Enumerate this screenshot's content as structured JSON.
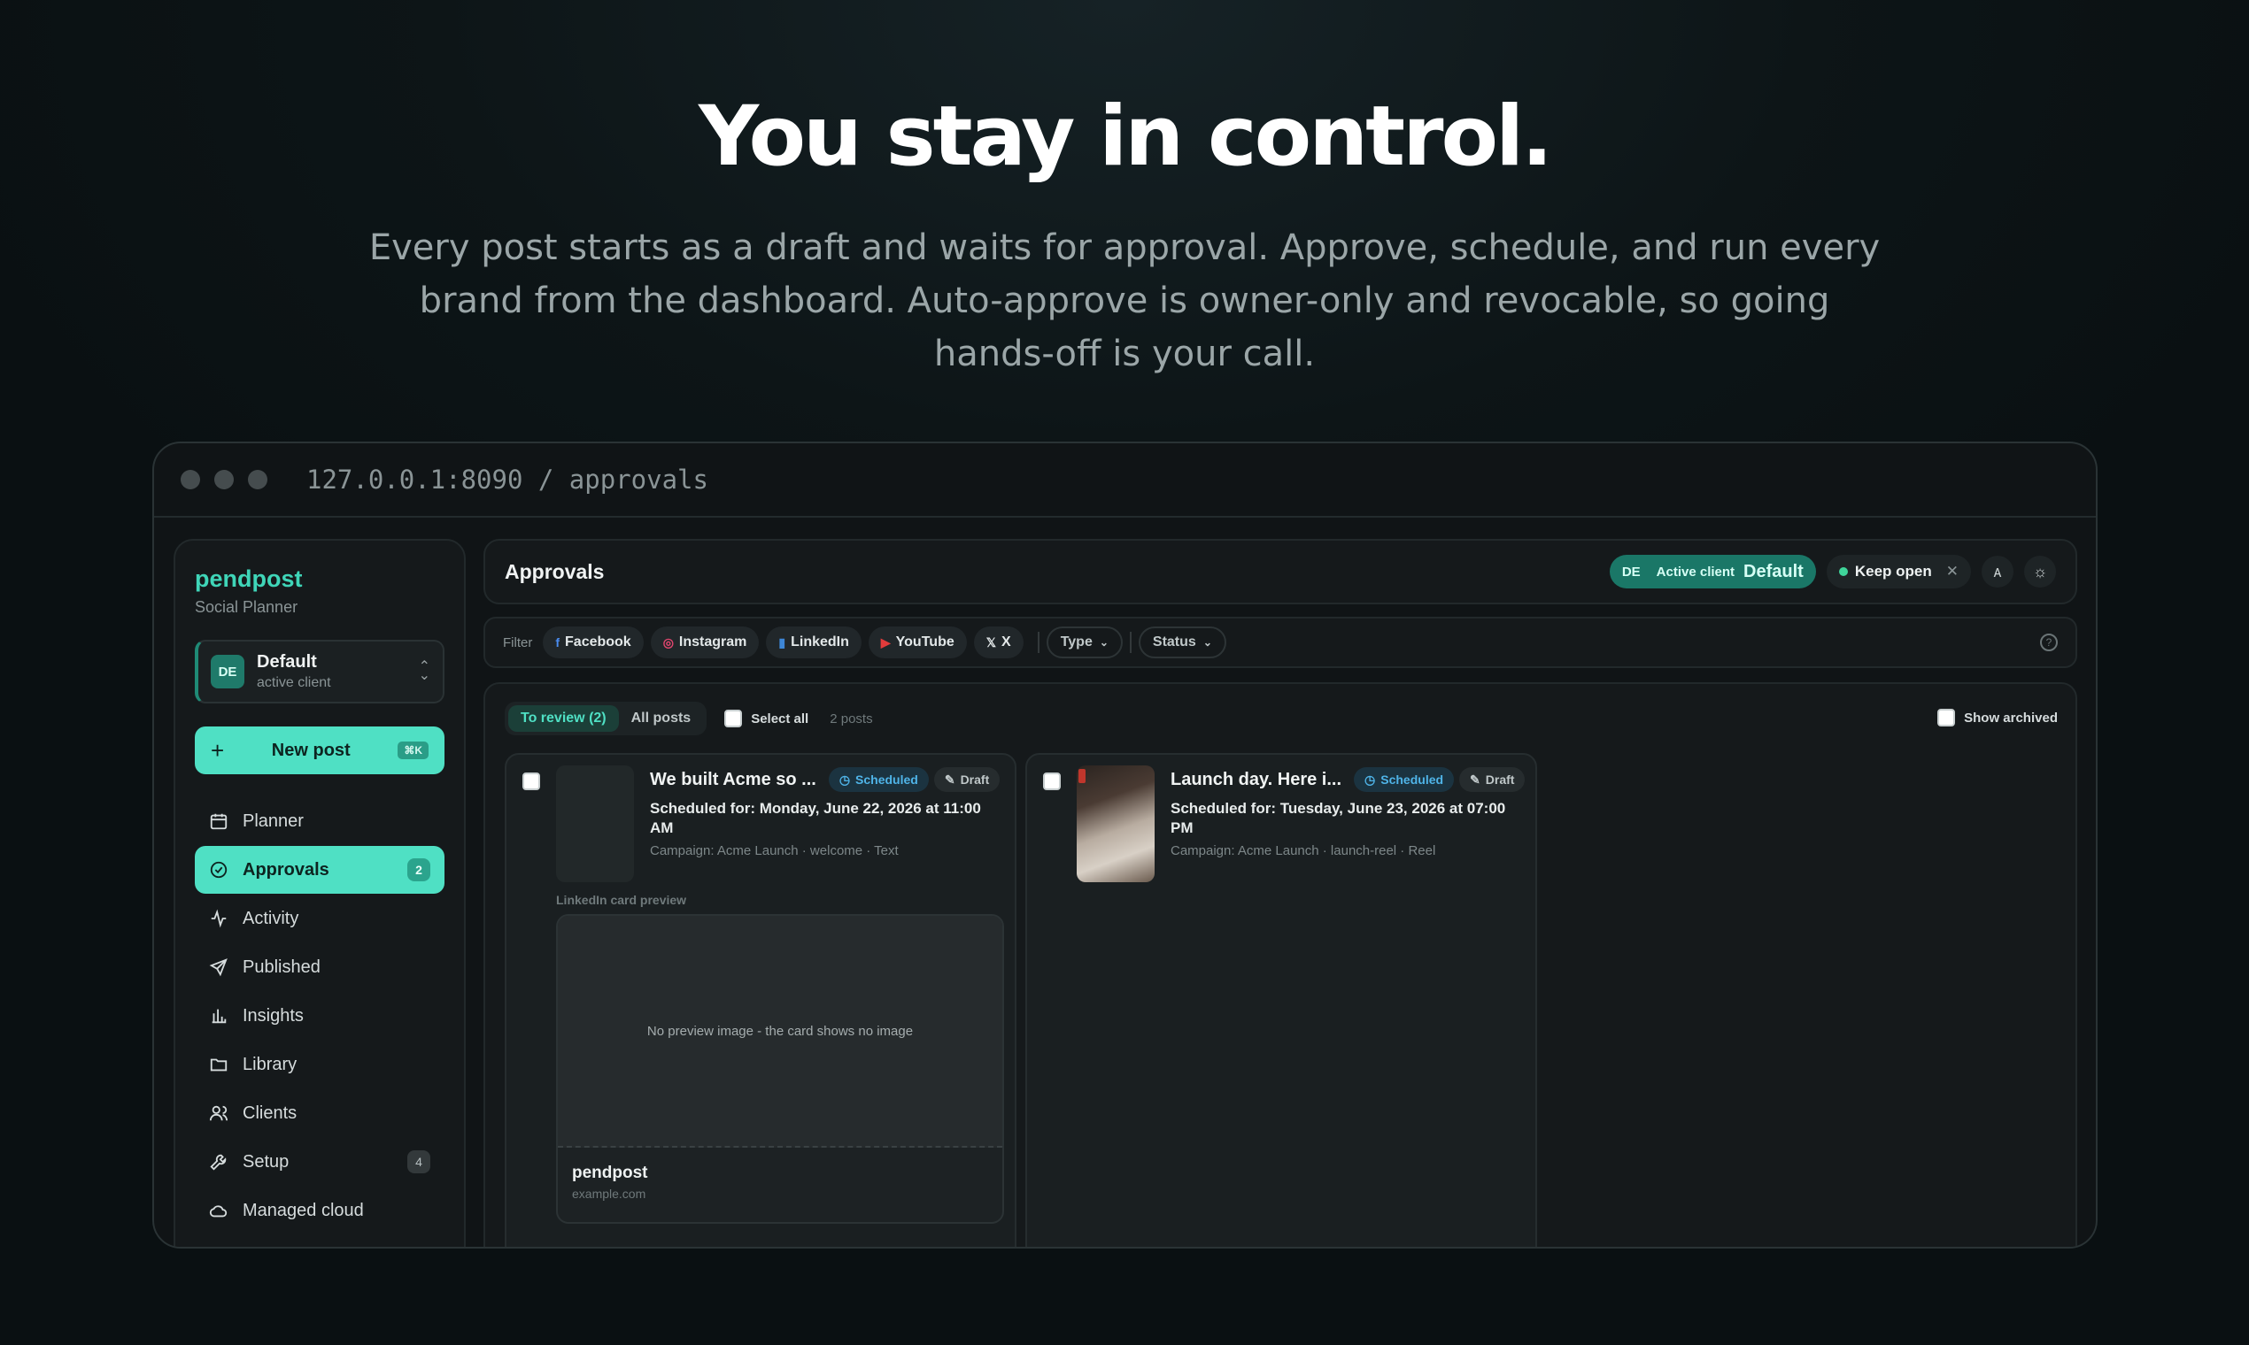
{
  "hero": {
    "title": "You stay in control.",
    "subtitle": "Every post starts as a draft and waits for approval. Approve, schedule, and run every brand from the dashboard. Auto-approve is owner-only and revocable, so going hands-off is your call."
  },
  "browser": {
    "url": "127.0.0.1:8090 / approvals"
  },
  "sidebar": {
    "brand": "pendpost",
    "brand_sub": "Social Planner",
    "client": {
      "initials": "DE",
      "name": "Default",
      "sub": "active client"
    },
    "new_post": {
      "label": "New post",
      "shortcut": "⌘K"
    },
    "items": [
      {
        "label": "Planner",
        "icon": "calendar-icon"
      },
      {
        "label": "Approvals",
        "icon": "check-circle-icon",
        "count": "2",
        "active": true
      },
      {
        "label": "Activity",
        "icon": "activity-icon"
      },
      {
        "label": "Published",
        "icon": "send-icon"
      },
      {
        "label": "Insights",
        "icon": "bar-chart-icon"
      },
      {
        "label": "Library",
        "icon": "folder-icon"
      },
      {
        "label": "Clients",
        "icon": "users-icon"
      },
      {
        "label": "Setup",
        "icon": "wrench-icon",
        "count": "4"
      },
      {
        "label": "Managed cloud",
        "icon": "cloud-icon"
      }
    ]
  },
  "topbar": {
    "title": "Approvals",
    "client_initials": "DE",
    "active_client_label": "Active client",
    "active_client_name": "Default",
    "keep_open": "Keep open"
  },
  "filter": {
    "label": "Filter",
    "platforms": [
      "Facebook",
      "Instagram",
      "LinkedIn",
      "YouTube",
      "X"
    ],
    "type": "Type",
    "status": "Status"
  },
  "list": {
    "tab_review": "To review (2)",
    "tab_all": "All posts",
    "select_all": "Select all",
    "count": "2 posts",
    "show_archived": "Show archived",
    "posts": [
      {
        "title": "We built Acme so ...",
        "status": "Scheduled",
        "state": "Draft",
        "scheduled": "Scheduled for: Monday, June 22, 2026 at 11:00 AM",
        "campaign": "Campaign: Acme Launch · welcome · Text",
        "preview_label": "LinkedIn card preview",
        "preview_empty": "No preview image - the card shows no image",
        "preview_name": "pendpost",
        "preview_domain": "example.com"
      },
      {
        "title": "Launch day. Here i...",
        "status": "Scheduled",
        "state": "Draft",
        "scheduled": "Scheduled for: Tuesday, June 23, 2026 at 07:00 PM",
        "campaign": "Campaign: Acme Launch · launch-reel · Reel"
      }
    ]
  },
  "colors": {
    "accent": "#4fe0c4",
    "brand": "#3fd5b8",
    "scheduled": "#4fb4e8"
  }
}
